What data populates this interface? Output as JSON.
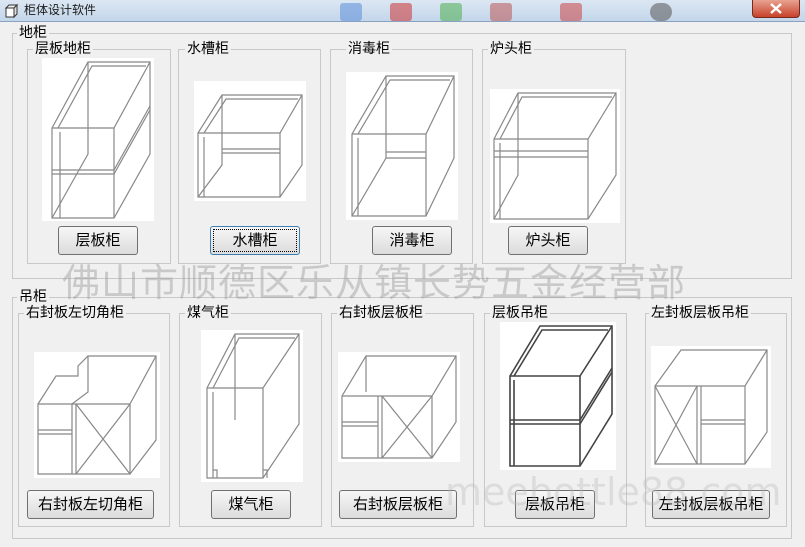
{
  "window": {
    "title": "柜体设计软件"
  },
  "groups": {
    "floor": {
      "label": "地柜"
    },
    "wall": {
      "label": "吊柜"
    }
  },
  "cabinets": [
    {
      "label": "层板地柜",
      "button": "层板柜",
      "icon": "shelf-floor-cabinet-drawing"
    },
    {
      "label": "水槽柜",
      "button": "水槽柜",
      "icon": "sink-cabinet-drawing"
    },
    {
      "label": "消毒柜",
      "button": "消毒柜",
      "icon": "disinfection-cabinet-drawing"
    },
    {
      "label": "炉头柜",
      "button": "炉头柜",
      "icon": "stove-cabinet-drawing"
    },
    {
      "label": "右封板左切角柜",
      "button": "右封板左切角柜",
      "icon": "corner-cabinet-drawing"
    },
    {
      "label": "煤气柜",
      "button": "煤气柜",
      "icon": "gas-cabinet-drawing"
    },
    {
      "label": "右封板层板柜",
      "button": "右封板层板柜",
      "icon": "right-panel-shelf-cabinet-drawing"
    },
    {
      "label": "层板吊柜",
      "button": "层板吊柜",
      "icon": "shelf-wall-cabinet-drawing"
    },
    {
      "label": "左封板层板吊柜",
      "button": "左封板层板吊柜",
      "icon": "left-panel-shelf-wall-cabinet-drawing"
    }
  ],
  "watermarks": {
    "main": "佛山市顺德区乐从镇长势五金经营部",
    "url": "meebottle88.com"
  }
}
